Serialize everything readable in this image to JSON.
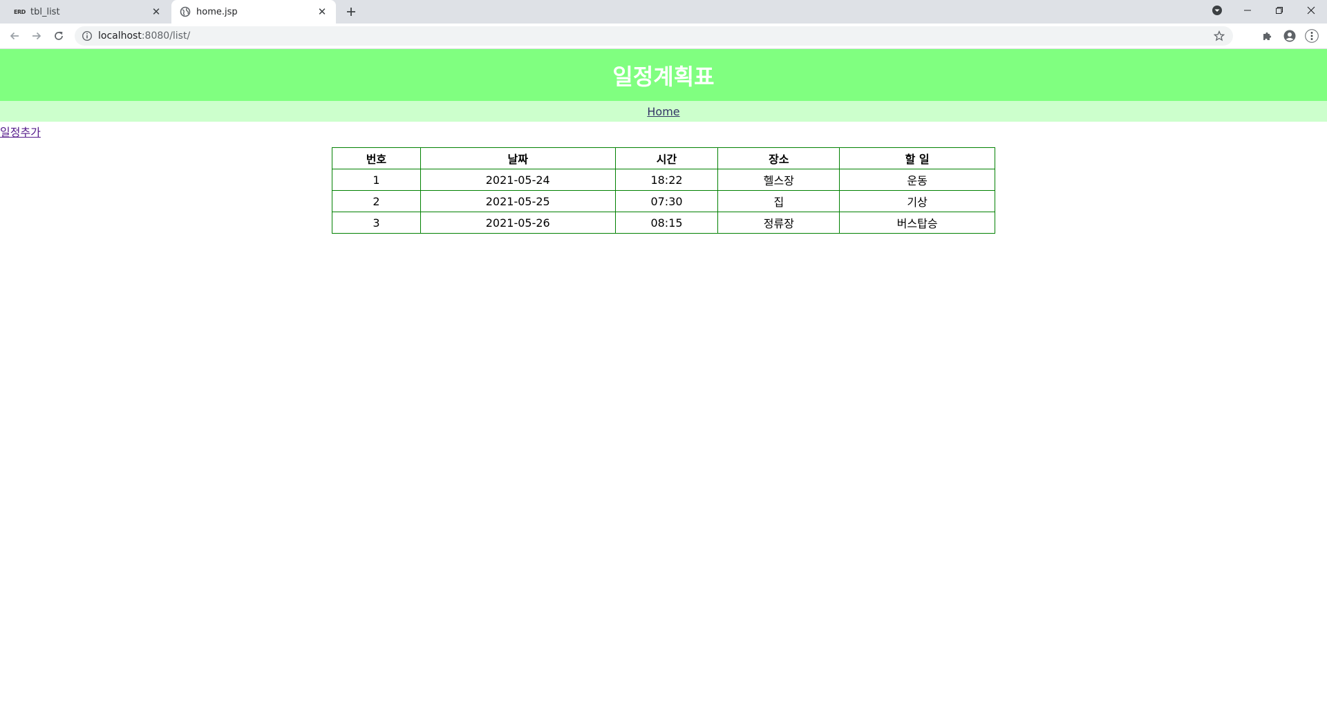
{
  "browser": {
    "tabs": [
      {
        "favicon": "ERD",
        "title": "tbl_list",
        "active": false
      },
      {
        "favicon": "globe-icon",
        "title": "home.jsp",
        "active": true
      }
    ],
    "url_host": "localhost",
    "url_path": ":8080/list/"
  },
  "page": {
    "title": "일정계획표",
    "nav_home": "Home",
    "add_link": "일정추가",
    "table": {
      "headers": [
        "번호",
        "날짜",
        "시간",
        "장소",
        "할 일"
      ],
      "rows": [
        [
          "1",
          "2021-05-24",
          "18:22",
          "헬스장",
          "운동"
        ],
        [
          "2",
          "2021-05-25",
          "07:30",
          "집",
          "기상"
        ],
        [
          "3",
          "2021-05-26",
          "08:15",
          "정류장",
          "버스탑승"
        ]
      ]
    }
  },
  "colors": {
    "header_bg": "#80ff80",
    "nav_bg": "#ccffcc",
    "table_border": "#008000"
  }
}
